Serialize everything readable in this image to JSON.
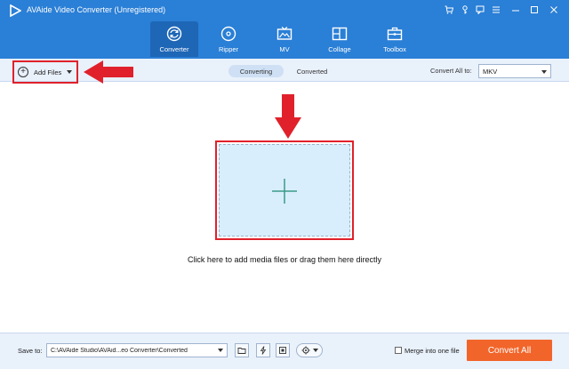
{
  "app": {
    "title": "AVAide Video Converter (Unregistered)",
    "accent": "#2a7fd6",
    "active_tab_color": "#1e66b6",
    "highlight_color": "#e0212b"
  },
  "window_controls": [
    {
      "name": "cart-icon"
    },
    {
      "name": "key-icon"
    },
    {
      "name": "feedback-icon"
    },
    {
      "name": "menu-icon"
    },
    {
      "name": "minimize-icon"
    },
    {
      "name": "maximize-icon"
    },
    {
      "name": "close-icon"
    }
  ],
  "main_tabs": [
    {
      "label": "Converter",
      "icon": "converter-icon",
      "active": true
    },
    {
      "label": "Ripper",
      "icon": "disc-icon",
      "active": false
    },
    {
      "label": "MV",
      "icon": "mv-icon",
      "active": false
    },
    {
      "label": "Collage",
      "icon": "collage-icon",
      "active": false
    },
    {
      "label": "Toolbox",
      "icon": "toolbox-icon",
      "active": false
    }
  ],
  "toolbar": {
    "add_files_label": "Add Files",
    "sub_tabs": [
      {
        "label": "Converting",
        "active": true
      },
      {
        "label": "Converted",
        "active": false
      }
    ],
    "convert_all_to_label": "Convert All to:",
    "format_value": "MKV"
  },
  "dropzone": {
    "hint": "Click here to add media files or drag them here directly"
  },
  "bottom": {
    "save_to_label": "Save to:",
    "path_value": "C:\\AVAide Studio\\AVAid...eo Converter\\Converted",
    "merge_label": "Merge into one file",
    "merge_checked": false,
    "convert_all_label": "Convert All",
    "convert_all_color": "#f2652a"
  }
}
